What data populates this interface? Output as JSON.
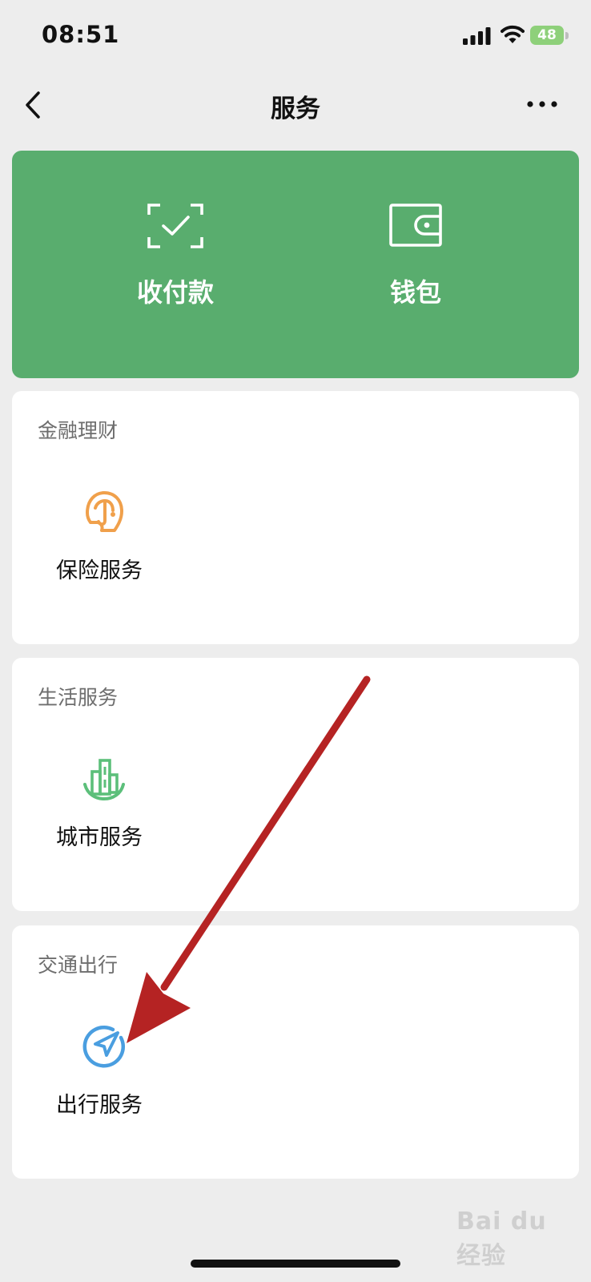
{
  "status_bar": {
    "time": "08:51",
    "battery": "48"
  },
  "nav": {
    "title": "服务"
  },
  "hero": {
    "items": [
      {
        "label": "收付款",
        "icon": "scan-check-icon"
      },
      {
        "label": "钱包",
        "icon": "wallet-icon"
      }
    ]
  },
  "sections": [
    {
      "title": "金融理财",
      "service": {
        "label": "保险服务",
        "icon": "insurance-umbrella-icon",
        "color": "#f0a04b"
      }
    },
    {
      "title": "生活服务",
      "service": {
        "label": "城市服务",
        "icon": "city-buildings-icon",
        "color": "#5cbf7a"
      }
    },
    {
      "title": "交通出行",
      "service": {
        "label": "出行服务",
        "icon": "navigation-arrow-icon",
        "color": "#4a9ee0"
      }
    }
  ],
  "colors": {
    "hero_green": "#59ad6e",
    "background": "#ededed",
    "annotation_arrow": "#b52323",
    "battery_green": "#8ed07a"
  },
  "watermark": {
    "text": "Bai du 经验"
  }
}
